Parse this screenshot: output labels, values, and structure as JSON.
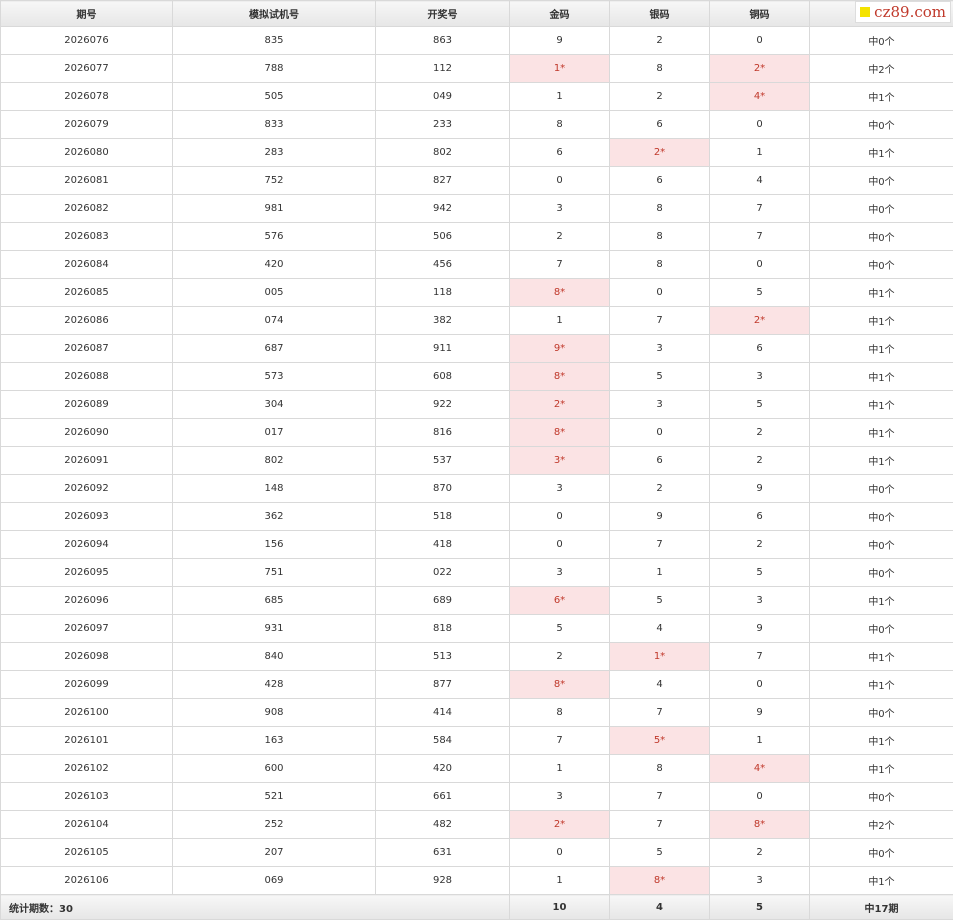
{
  "headers": [
    "期号",
    "模拟试机号",
    "开奖号",
    "金码",
    "银码",
    "铜码",
    ""
  ],
  "watermark": "cz89.com",
  "rows": [
    {
      "period": "2026076",
      "sim": "835",
      "draw": "863",
      "gold": "9",
      "gold_hit": false,
      "silver": "2",
      "silver_hit": false,
      "bronze": "0",
      "bronze_hit": false,
      "result": "中0个"
    },
    {
      "period": "2026077",
      "sim": "788",
      "draw": "112",
      "gold": "1*",
      "gold_hit": true,
      "silver": "8",
      "silver_hit": false,
      "bronze": "2*",
      "bronze_hit": true,
      "result": "中2个"
    },
    {
      "period": "2026078",
      "sim": "505",
      "draw": "049",
      "gold": "1",
      "gold_hit": false,
      "silver": "2",
      "silver_hit": false,
      "bronze": "4*",
      "bronze_hit": true,
      "result": "中1个"
    },
    {
      "period": "2026079",
      "sim": "833",
      "draw": "233",
      "gold": "8",
      "gold_hit": false,
      "silver": "6",
      "silver_hit": false,
      "bronze": "0",
      "bronze_hit": false,
      "result": "中0个"
    },
    {
      "period": "2026080",
      "sim": "283",
      "draw": "802",
      "gold": "6",
      "gold_hit": false,
      "silver": "2*",
      "silver_hit": true,
      "bronze": "1",
      "bronze_hit": false,
      "result": "中1个"
    },
    {
      "period": "2026081",
      "sim": "752",
      "draw": "827",
      "gold": "0",
      "gold_hit": false,
      "silver": "6",
      "silver_hit": false,
      "bronze": "4",
      "bronze_hit": false,
      "result": "中0个"
    },
    {
      "period": "2026082",
      "sim": "981",
      "draw": "942",
      "gold": "3",
      "gold_hit": false,
      "silver": "8",
      "silver_hit": false,
      "bronze": "7",
      "bronze_hit": false,
      "result": "中0个"
    },
    {
      "period": "2026083",
      "sim": "576",
      "draw": "506",
      "gold": "2",
      "gold_hit": false,
      "silver": "8",
      "silver_hit": false,
      "bronze": "7",
      "bronze_hit": false,
      "result": "中0个"
    },
    {
      "period": "2026084",
      "sim": "420",
      "draw": "456",
      "gold": "7",
      "gold_hit": false,
      "silver": "8",
      "silver_hit": false,
      "bronze": "0",
      "bronze_hit": false,
      "result": "中0个"
    },
    {
      "period": "2026085",
      "sim": "005",
      "draw": "118",
      "gold": "8*",
      "gold_hit": true,
      "silver": "0",
      "silver_hit": false,
      "bronze": "5",
      "bronze_hit": false,
      "result": "中1个"
    },
    {
      "period": "2026086",
      "sim": "074",
      "draw": "382",
      "gold": "1",
      "gold_hit": false,
      "silver": "7",
      "silver_hit": false,
      "bronze": "2*",
      "bronze_hit": true,
      "result": "中1个"
    },
    {
      "period": "2026087",
      "sim": "687",
      "draw": "911",
      "gold": "9*",
      "gold_hit": true,
      "silver": "3",
      "silver_hit": false,
      "bronze": "6",
      "bronze_hit": false,
      "result": "中1个"
    },
    {
      "period": "2026088",
      "sim": "573",
      "draw": "608",
      "gold": "8*",
      "gold_hit": true,
      "silver": "5",
      "silver_hit": false,
      "bronze": "3",
      "bronze_hit": false,
      "result": "中1个"
    },
    {
      "period": "2026089",
      "sim": "304",
      "draw": "922",
      "gold": "2*",
      "gold_hit": true,
      "silver": "3",
      "silver_hit": false,
      "bronze": "5",
      "bronze_hit": false,
      "result": "中1个"
    },
    {
      "period": "2026090",
      "sim": "017",
      "draw": "816",
      "gold": "8*",
      "gold_hit": true,
      "silver": "0",
      "silver_hit": false,
      "bronze": "2",
      "bronze_hit": false,
      "result": "中1个"
    },
    {
      "period": "2026091",
      "sim": "802",
      "draw": "537",
      "gold": "3*",
      "gold_hit": true,
      "silver": "6",
      "silver_hit": false,
      "bronze": "2",
      "bronze_hit": false,
      "result": "中1个"
    },
    {
      "period": "2026092",
      "sim": "148",
      "draw": "870",
      "gold": "3",
      "gold_hit": false,
      "silver": "2",
      "silver_hit": false,
      "bronze": "9",
      "bronze_hit": false,
      "result": "中0个"
    },
    {
      "period": "2026093",
      "sim": "362",
      "draw": "518",
      "gold": "0",
      "gold_hit": false,
      "silver": "9",
      "silver_hit": false,
      "bronze": "6",
      "bronze_hit": false,
      "result": "中0个"
    },
    {
      "period": "2026094",
      "sim": "156",
      "draw": "418",
      "gold": "0",
      "gold_hit": false,
      "silver": "7",
      "silver_hit": false,
      "bronze": "2",
      "bronze_hit": false,
      "result": "中0个"
    },
    {
      "period": "2026095",
      "sim": "751",
      "draw": "022",
      "gold": "3",
      "gold_hit": false,
      "silver": "1",
      "silver_hit": false,
      "bronze": "5",
      "bronze_hit": false,
      "result": "中0个"
    },
    {
      "period": "2026096",
      "sim": "685",
      "draw": "689",
      "gold": "6*",
      "gold_hit": true,
      "silver": "5",
      "silver_hit": false,
      "bronze": "3",
      "bronze_hit": false,
      "result": "中1个"
    },
    {
      "period": "2026097",
      "sim": "931",
      "draw": "818",
      "gold": "5",
      "gold_hit": false,
      "silver": "4",
      "silver_hit": false,
      "bronze": "9",
      "bronze_hit": false,
      "result": "中0个"
    },
    {
      "period": "2026098",
      "sim": "840",
      "draw": "513",
      "gold": "2",
      "gold_hit": false,
      "silver": "1*",
      "silver_hit": true,
      "bronze": "7",
      "bronze_hit": false,
      "result": "中1个"
    },
    {
      "period": "2026099",
      "sim": "428",
      "draw": "877",
      "gold": "8*",
      "gold_hit": true,
      "silver": "4",
      "silver_hit": false,
      "bronze": "0",
      "bronze_hit": false,
      "result": "中1个"
    },
    {
      "period": "2026100",
      "sim": "908",
      "draw": "414",
      "gold": "8",
      "gold_hit": false,
      "silver": "7",
      "silver_hit": false,
      "bronze": "9",
      "bronze_hit": false,
      "result": "中0个"
    },
    {
      "period": "2026101",
      "sim": "163",
      "draw": "584",
      "gold": "7",
      "gold_hit": false,
      "silver": "5*",
      "silver_hit": true,
      "bronze": "1",
      "bronze_hit": false,
      "result": "中1个"
    },
    {
      "period": "2026102",
      "sim": "600",
      "draw": "420",
      "gold": "1",
      "gold_hit": false,
      "silver": "8",
      "silver_hit": false,
      "bronze": "4*",
      "bronze_hit": true,
      "result": "中1个"
    },
    {
      "period": "2026103",
      "sim": "521",
      "draw": "661",
      "gold": "3",
      "gold_hit": false,
      "silver": "7",
      "silver_hit": false,
      "bronze": "0",
      "bronze_hit": false,
      "result": "中0个"
    },
    {
      "period": "2026104",
      "sim": "252",
      "draw": "482",
      "gold": "2*",
      "gold_hit": true,
      "silver": "7",
      "silver_hit": false,
      "bronze": "8*",
      "bronze_hit": true,
      "result": "中2个"
    },
    {
      "period": "2026105",
      "sim": "207",
      "draw": "631",
      "gold": "0",
      "gold_hit": false,
      "silver": "5",
      "silver_hit": false,
      "bronze": "2",
      "bronze_hit": false,
      "result": "中0个"
    },
    {
      "period": "2026106",
      "sim": "069",
      "draw": "928",
      "gold": "1",
      "gold_hit": false,
      "silver": "8*",
      "silver_hit": true,
      "bronze": "3",
      "bronze_hit": false,
      "result": "中1个"
    }
  ],
  "footer": {
    "label": "统计期数：30",
    "gold_total": "10",
    "silver_total": "4",
    "bronze_total": "5",
    "result_total": "中17期"
  },
  "colors": {
    "hit_bg": "#fbe3e4",
    "hit_text": "#c0392b",
    "header_bg": "#eeeeee",
    "border": "#d9d9d9"
  }
}
